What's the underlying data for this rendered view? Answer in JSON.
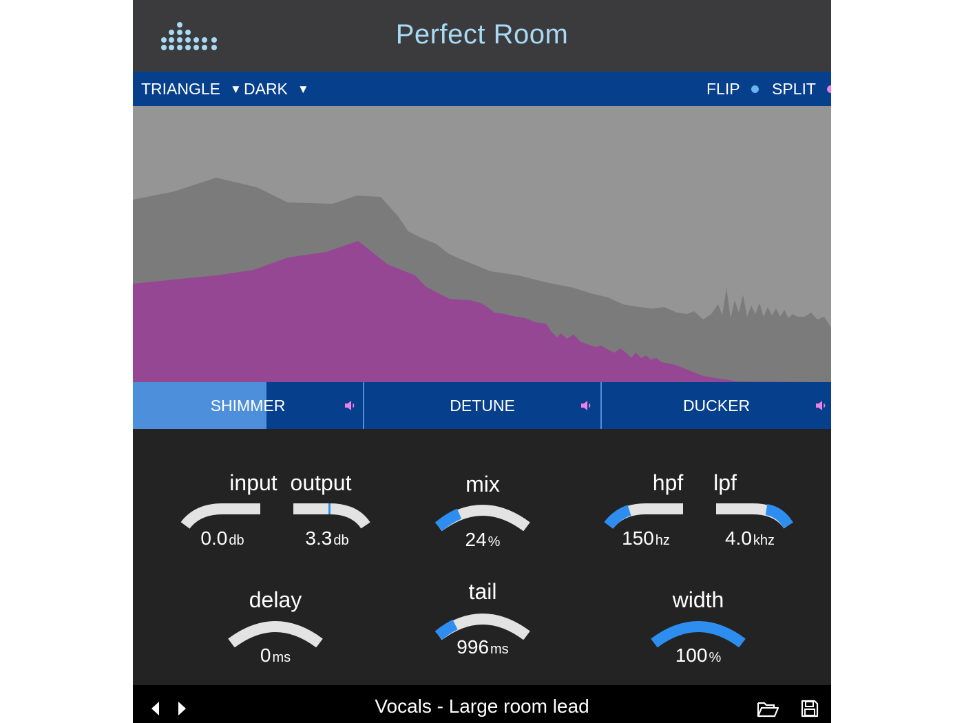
{
  "header": {
    "title": "Perfect Room",
    "logo_icon": "dot-matrix-logo-icon"
  },
  "toolbar": {
    "shape_label": "TRIANGLE",
    "theme_label": "DARK",
    "flip_label": "FLIP",
    "flip_color": "#6cb4f0",
    "split_label": "SPLIT",
    "split_color": "#f07fe6"
  },
  "spectrum": {
    "background_color": "#969596",
    "input_color": "#7b7b7c",
    "output_color": "#964794"
  },
  "tabs": [
    {
      "label": "SHIMMER",
      "level": 0.58,
      "speaker_icon": "speaker-icon"
    },
    {
      "label": "DETUNE",
      "level": 0,
      "speaker_icon": "speaker-icon"
    },
    {
      "label": "DUCKER",
      "level": 0,
      "speaker_icon": "speaker-icon"
    }
  ],
  "knobs": {
    "input": {
      "label": "input",
      "value": "0.0",
      "unit": "db"
    },
    "output": {
      "label": "output",
      "value": "3.3",
      "unit": "db"
    },
    "mix": {
      "label": "mix",
      "value": "24",
      "unit": "%"
    },
    "hpf": {
      "label": "hpf",
      "value": "150",
      "unit": "hz"
    },
    "lpf": {
      "label": "lpf",
      "value": "4.0",
      "unit": "khz"
    },
    "delay": {
      "label": "delay",
      "value": "0",
      "unit": "ms"
    },
    "tail": {
      "label": "tail",
      "value": "996",
      "unit": "ms"
    },
    "width": {
      "label": "width",
      "value": "100",
      "unit": "%"
    }
  },
  "colors": {
    "accent": "#2e8ef0",
    "track": "#e3e3e3",
    "nav_blue": "#063f8c",
    "tab_highlight": "#4e8fdb"
  },
  "footer": {
    "preset_name": "Vocals - Large room lead"
  }
}
